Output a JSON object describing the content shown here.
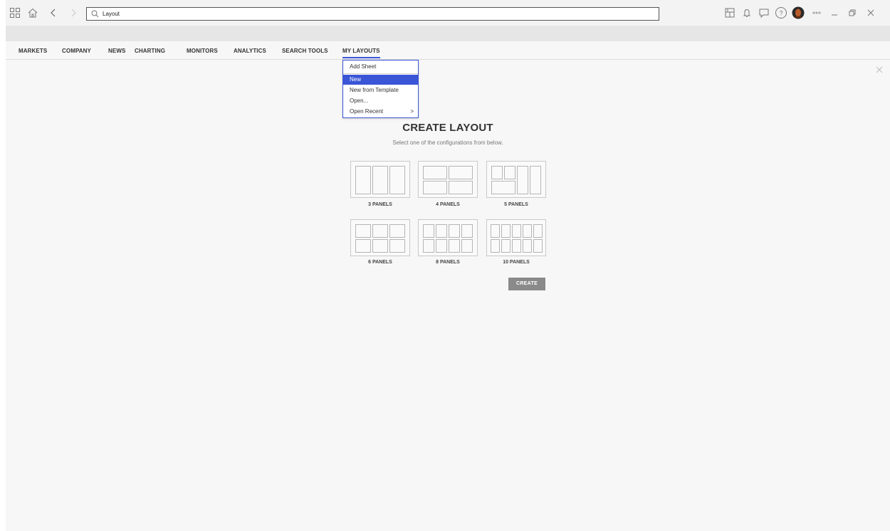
{
  "search": {
    "value": "Layout"
  },
  "nav": {
    "items": [
      {
        "label": "MARKETS"
      },
      {
        "label": "COMPANY"
      },
      {
        "label": "NEWS"
      },
      {
        "label": "CHARTING"
      },
      {
        "label": "MONITORS"
      },
      {
        "label": "ANALYTICS"
      },
      {
        "label": "SEARCH TOOLS"
      },
      {
        "label": "MY LAYOUTS"
      }
    ],
    "active": "MY LAYOUTS"
  },
  "menu": {
    "items": [
      {
        "label": "Add Sheet"
      },
      {
        "label": "New"
      },
      {
        "label": "New from Template"
      },
      {
        "label": "Open..."
      },
      {
        "label": "Open Recent",
        "submenu_arrow": ">"
      }
    ],
    "highlighted": "New"
  },
  "create_layout": {
    "title": "CREATE LAYOUT",
    "subtitle": "Select one of the configurations from below.",
    "options": [
      {
        "label": "3 PANELS"
      },
      {
        "label": "4 PANELS"
      },
      {
        "label": "5 PANELS"
      },
      {
        "label": "6 PANELS"
      },
      {
        "label": "8 PANELS"
      },
      {
        "label": "10 PANELS"
      }
    ],
    "button_label": "CREATE"
  },
  "colors": {
    "accent": "#3a55d6",
    "button": "#8a8a8a",
    "background": "#f7f7f7"
  },
  "icons": [
    "apps-grid-icon",
    "home-icon",
    "back-arrow-icon",
    "forward-arrow-icon",
    "search-icon",
    "layout-icon",
    "bell-icon",
    "chat-icon",
    "help-icon",
    "avatar",
    "more-icon",
    "minimize-icon",
    "restore-icon",
    "close-icon"
  ]
}
